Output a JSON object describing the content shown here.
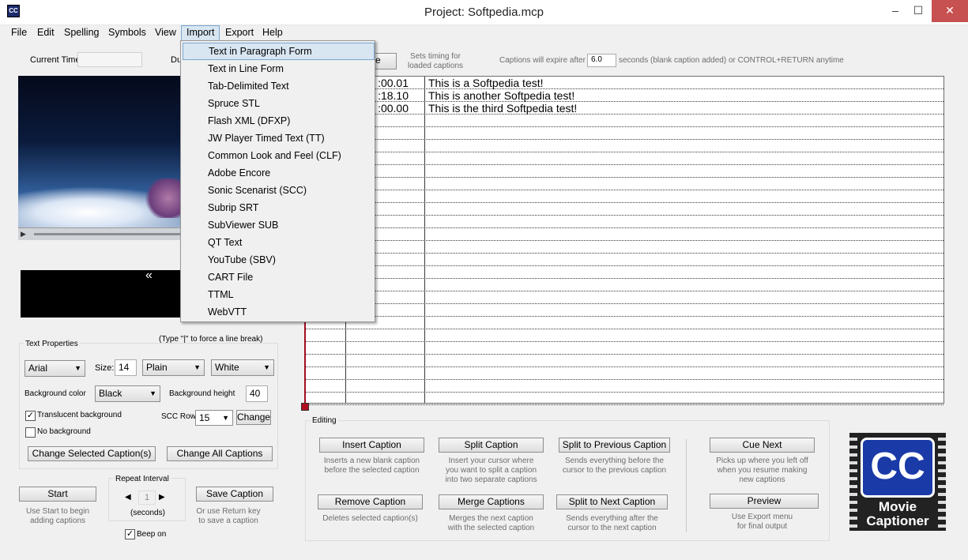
{
  "window": {
    "title": "Project: Softpedia.mcp",
    "app_icon": "CC",
    "minimize": "‒",
    "maximize": "☐",
    "close": "✕"
  },
  "menu": [
    "File",
    "Edit",
    "Spelling",
    "Symbols",
    "View",
    "Import",
    "Export",
    "Help"
  ],
  "import_menu": [
    "Text in Paragraph Form",
    "Text in Line Form",
    "Tab-Delimited Text",
    "Spruce STL",
    "Flash XML (DFXP)",
    "JW Player Timed Text (TT)",
    "Common Look and Feel (CLF)",
    "Adobe Encore",
    "Sonic Scenarist (SCC)",
    "Subrip SRT",
    "SubViewer SUB",
    "QT Text",
    "YouTube (SBV)",
    "CART File",
    "TTML",
    "WebVTT"
  ],
  "top": {
    "current_time_label": "Current Time:",
    "duration_label_partial": "Du",
    "sets_timing_hint": "Sets timing for\nloaded captions",
    "expire_label": "Captions will expire after",
    "expire_value": "6.0",
    "expire_suffix": "seconds (blank caption added) or CONTROL+RETURN anytime",
    "hidden_button_partial": "e"
  },
  "captions": [
    {
      "time": ":00.01",
      "text": "This is a Softpedia test!"
    },
    {
      "time": ":18.10",
      "text": "This is another Softpedia test!"
    },
    {
      "time": ":00.00",
      "text": "This is the third Softpedia test!"
    }
  ],
  "nav_symbol": "«",
  "text_props": {
    "legend": "Text Properties",
    "line_break_hint": "(Type  \"|\" to force a line break)",
    "font": "Arial",
    "size_label": "Size:",
    "size": "14",
    "style": "Plain",
    "color": "White",
    "bg_color_label": "Background color",
    "bg_color": "Black",
    "bg_height_label": "Background height",
    "bg_height": "40",
    "translucent": "Translucent background",
    "no_background": "No background",
    "scc_row_label": "SCC Row:",
    "scc_row": "15",
    "change": "Change",
    "change_selected": "Change Selected Caption(s)",
    "change_all": "Change All Captions"
  },
  "bottom_left": {
    "start": "Start",
    "start_hint": "Use Start to begin\nadding captions",
    "repeat_label": "Repeat Interval",
    "repeat_value": "1",
    "repeat_unit": "(seconds)",
    "beep": "Beep on",
    "save": "Save Caption",
    "save_hint": "Or use Return key\nto save a caption"
  },
  "editing": {
    "legend": "Editing",
    "insert": "Insert Caption",
    "insert_hint": "Inserts a new blank caption\nbefore the selected caption",
    "split": "Split Caption",
    "split_hint": "Insert your cursor where\nyou want to split a caption\ninto two separate captions",
    "split_prev": "Split to Previous Caption",
    "split_prev_hint": "Sends everything before the\ncursor to the previous caption",
    "remove": "Remove Caption",
    "remove_hint": "Deletes selected caption(s)",
    "merge": "Merge Captions",
    "merge_hint": "Merges the next caption\nwith the selected caption",
    "split_next": "Split to Next Caption",
    "split_next_hint": "Sends everything after the\ncursor to the next caption",
    "cue_next": "Cue Next",
    "cue_hint": "Picks up where you left off\nwhen you resume making\nnew captions",
    "preview": "Preview",
    "preview_hint": "Use Export menu\nfor final output"
  },
  "logo": {
    "cc": "CC",
    "line1": "Movie",
    "line2": "Captioner"
  }
}
